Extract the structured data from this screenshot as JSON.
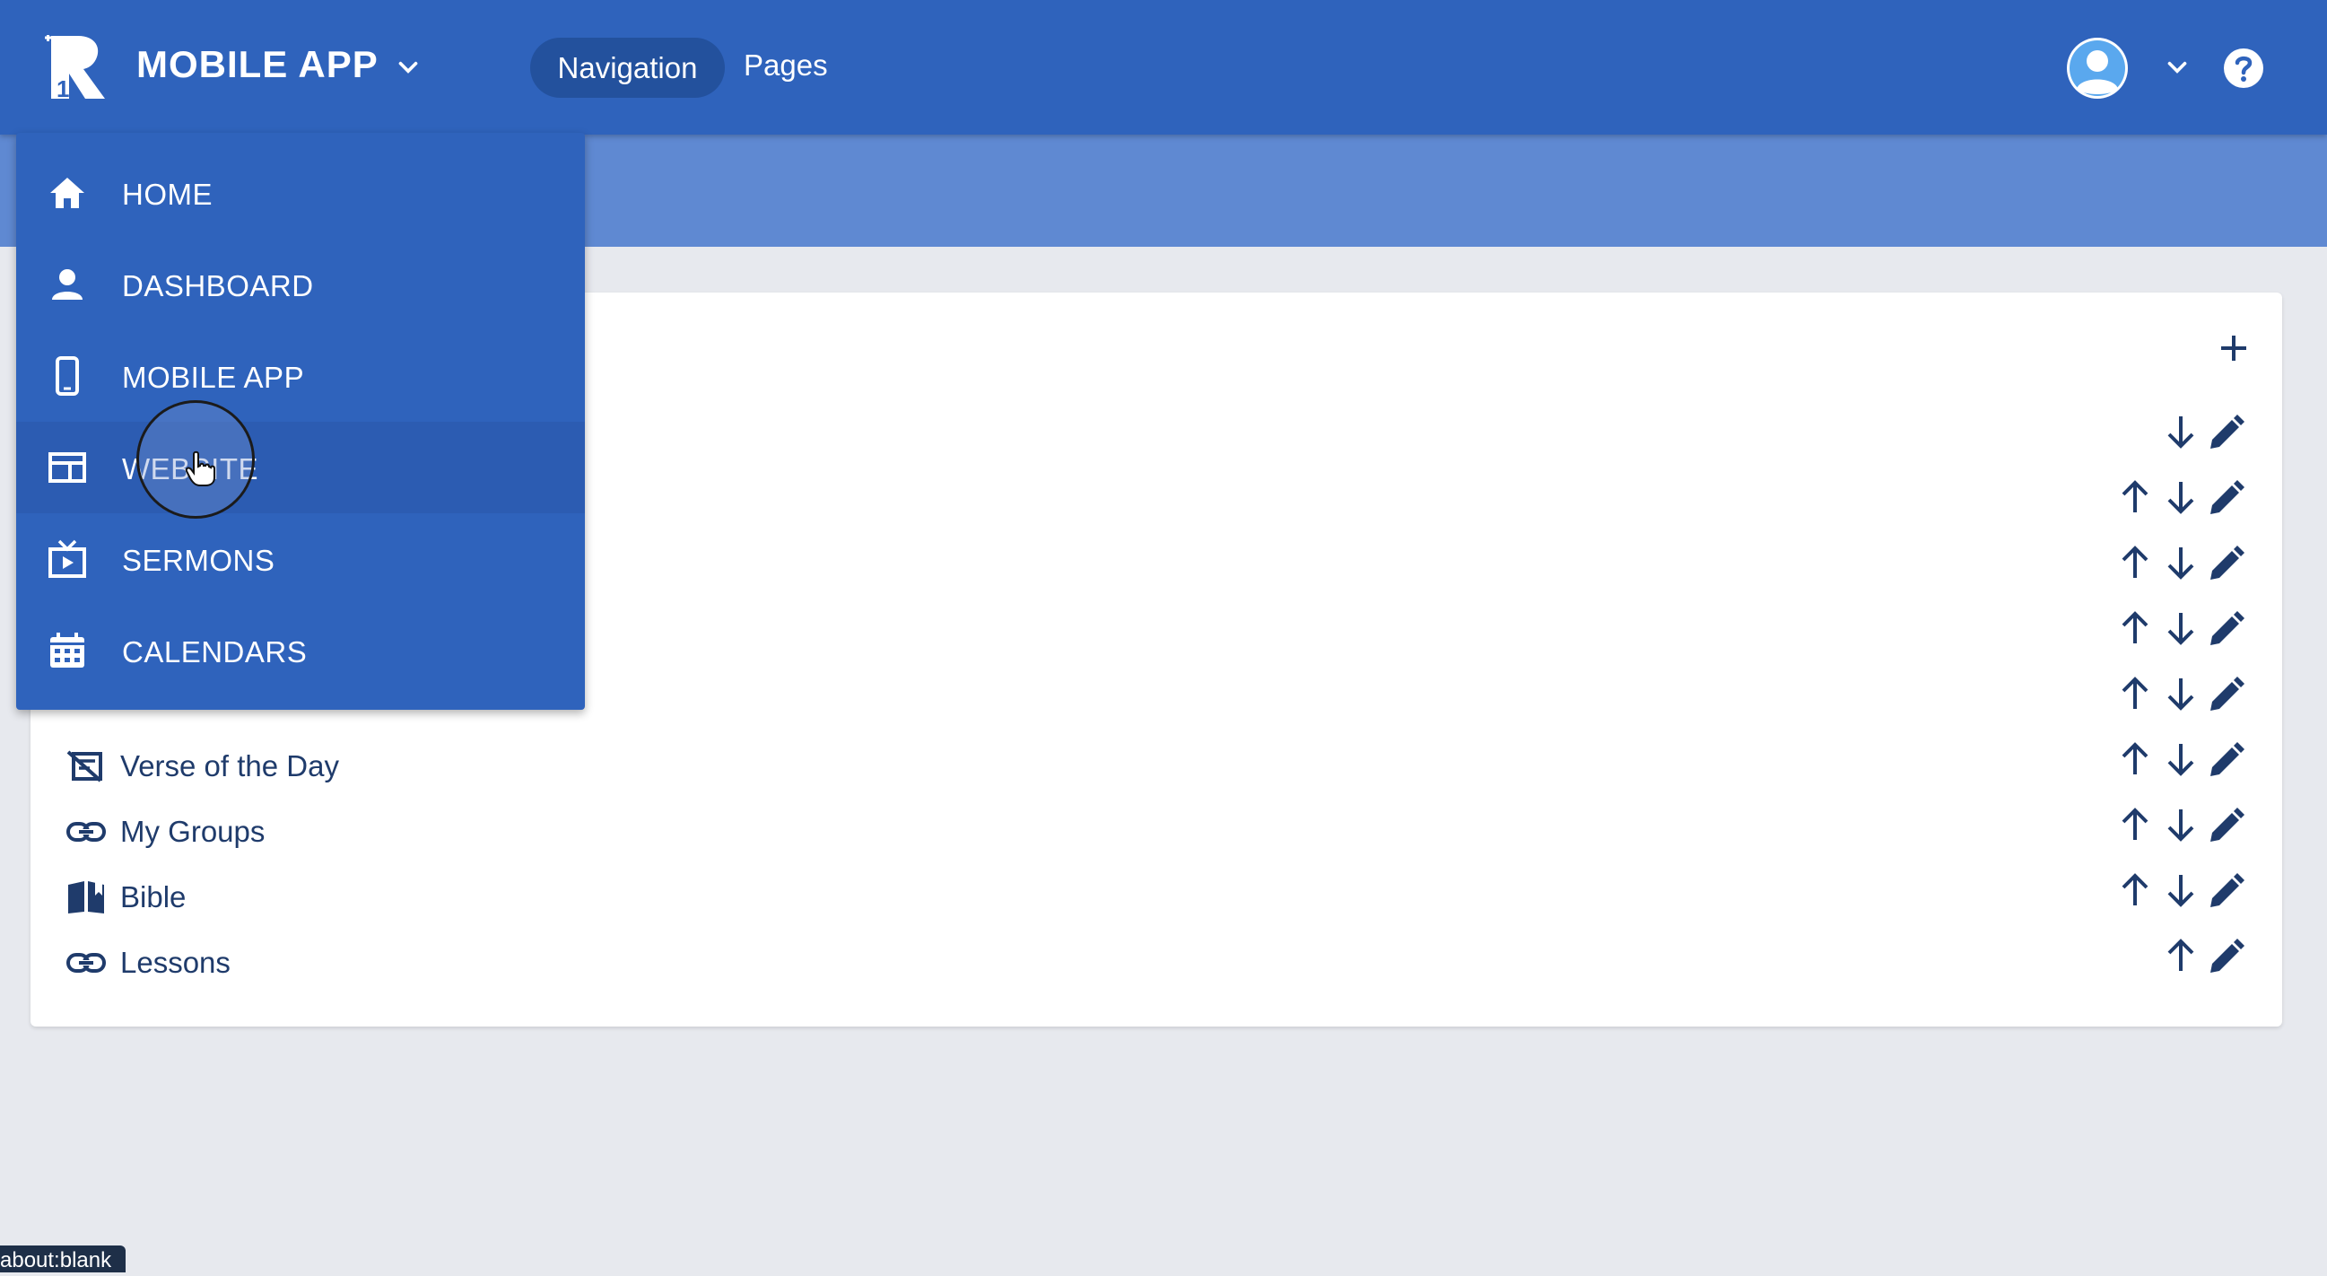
{
  "header": {
    "app_title": "MOBILE APP",
    "tabs": [
      {
        "label": "Navigation",
        "active": true
      },
      {
        "label": "Pages",
        "active": false
      }
    ]
  },
  "menu": {
    "items": [
      {
        "label": "HOME",
        "icon": "home-icon"
      },
      {
        "label": "DASHBOARD",
        "icon": "person-icon"
      },
      {
        "label": "MOBILE APP",
        "icon": "phone-icon"
      },
      {
        "label": "WEBSITE",
        "icon": "website-icon"
      },
      {
        "label": "SERMONS",
        "icon": "video-icon"
      },
      {
        "label": "CALENDARS",
        "icon": "calendar-icon"
      }
    ]
  },
  "nav_list": {
    "items": [
      {
        "label": "Verse of the Day",
        "icon": "verse-icon"
      },
      {
        "label": "My Groups",
        "icon": "link-icon"
      },
      {
        "label": "Bible",
        "icon": "book-icon"
      },
      {
        "label": "Lessons",
        "icon": "link-icon"
      }
    ]
  },
  "status_bar": {
    "url": "about:blank"
  },
  "colors": {
    "header_blue": "#2f63bc",
    "subheader_blue": "#5f89d2",
    "active_tab": "#23519d",
    "icon_navy": "#1f3b6b",
    "background": "#e7e9ee"
  }
}
